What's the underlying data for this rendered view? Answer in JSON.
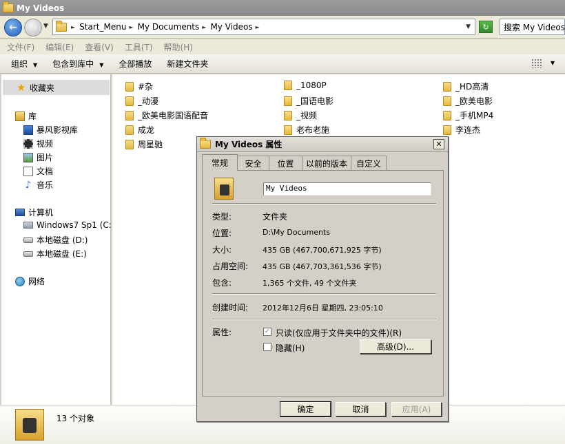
{
  "window": {
    "title": "My Videos"
  },
  "address": {
    "crumbs": [
      "Start_Menu",
      "My Documents",
      "My Videos"
    ],
    "search_placeholder": "搜索 My Videos"
  },
  "menu": [
    "文件(F)",
    "编辑(E)",
    "查看(V)",
    "工具(T)",
    "帮助(H)"
  ],
  "toolbar": {
    "organize": "组织",
    "include_library": "包含到库中",
    "play_all": "全部播放",
    "new_folder": "新建文件夹"
  },
  "nav": {
    "favorites": "收藏夹",
    "libraries": "库",
    "lib_items": [
      "暴风影视库",
      "视频",
      "图片",
      "文档",
      "音乐"
    ],
    "computer": "计算机",
    "drives": [
      "Windows7 Sp1 (C:)",
      "本地磁盘 (D:)",
      "本地磁盘 (E:)"
    ],
    "network": "网络"
  },
  "files": {
    "col1": [
      "#杂",
      "_动漫",
      "_欧美电影国语配音",
      "成龙",
      "周星驰"
    ],
    "col2": [
      "_1080P",
      "_国语电影",
      "_视频",
      "老布老施"
    ],
    "col3": [
      "_HD高清",
      "_欧美电影",
      "_手机MP4",
      "李连杰"
    ]
  },
  "details": {
    "count": "13 个对象"
  },
  "dialog": {
    "title": "My Videos 属性",
    "tabs": [
      "常规",
      "安全",
      "位置",
      "以前的版本",
      "自定义"
    ],
    "name_value": "My Videos",
    "type_label": "类型:",
    "type_value": "文件夹",
    "location_label": "位置:",
    "location_value": "D:\\My Documents",
    "size_label": "大小:",
    "size_value": "435 GB (467,700,671,925 字节)",
    "disk_size_label": "占用空间:",
    "disk_size_value": "435 GB (467,703,361,536 字节)",
    "contains_label": "包含:",
    "contains_value": "1,365 个文件, 49 个文件夹",
    "created_label": "创建时间:",
    "created_value": "2012年12月6日 星期四, 23:05:10",
    "attributes_label": "属性:",
    "readonly_label": "只读(仅应用于文件夹中的文件)(R)",
    "hidden_label": "隐藏(H)",
    "advanced_button": "高级(D)...",
    "ok_button": "确定",
    "cancel_button": "取消",
    "apply_button": "应用(A)"
  }
}
